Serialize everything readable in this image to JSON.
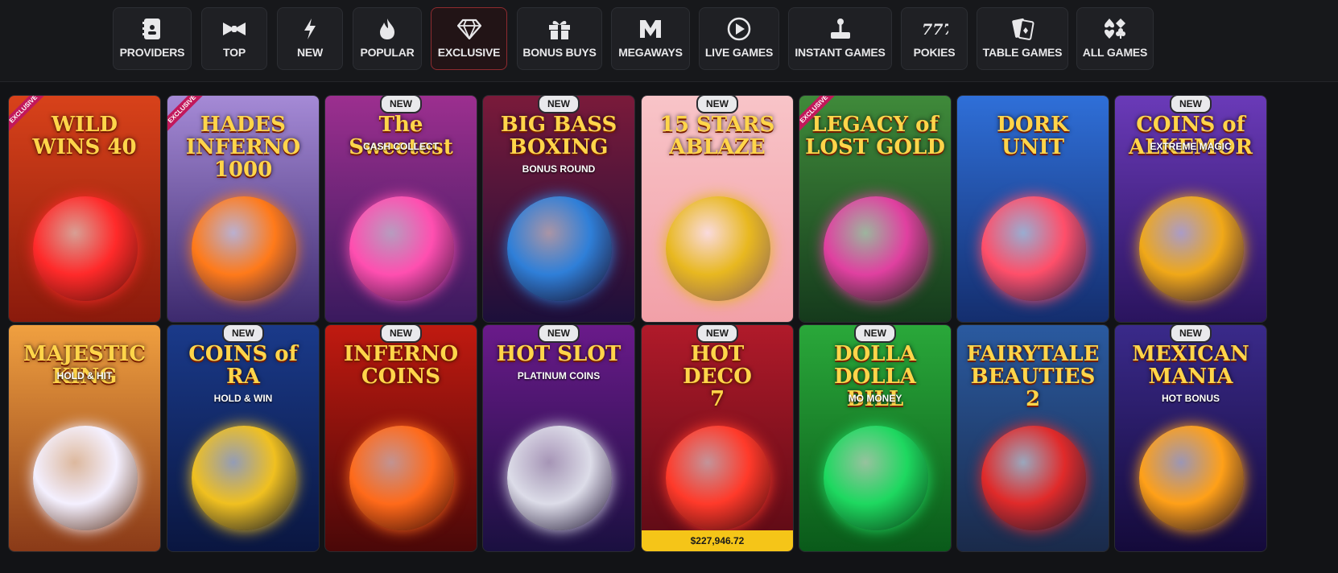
{
  "categories": [
    {
      "label": "PROVIDERS",
      "icon": "book-icon"
    },
    {
      "label": "TOP",
      "icon": "bowtie-icon"
    },
    {
      "label": "NEW",
      "icon": "lightning-icon"
    },
    {
      "label": "POPULAR",
      "icon": "flame-icon"
    },
    {
      "label": "EXCLUSIVE",
      "icon": "diamond-icon",
      "active": true
    },
    {
      "label": "BONUS BUYS",
      "icon": "gift-icon"
    },
    {
      "label": "MEGAWAYS",
      "icon": "megaways-m-icon"
    },
    {
      "label": "LIVE GAMES",
      "icon": "play-icon"
    },
    {
      "label": "INSTANT GAMES",
      "icon": "joystick-icon"
    },
    {
      "label": "POKIES",
      "icon": "777-icon"
    },
    {
      "label": "TABLE GAMES",
      "icon": "cards-icon"
    },
    {
      "label": "ALL GAMES",
      "icon": "card-suits-icon"
    }
  ],
  "badges": {
    "new": "NEW",
    "exclusive": "EXCLUSIVE"
  },
  "games": [
    {
      "title": "WILD\nWINS 40",
      "badge": "exclusive",
      "colors": [
        "#d8421a",
        "#8a1a0c"
      ],
      "accent": "#ff2a2a"
    },
    {
      "title": "HADES\nINFERNO\n1000",
      "badge": "exclusive",
      "colors": [
        "#a58ad6",
        "#3d2a6e"
      ],
      "accent": "#ff7a1a"
    },
    {
      "title": "The Sweetest",
      "subtitle": "CASH COLLECT",
      "badge": "new",
      "colors": [
        "#9c2f8f",
        "#3a1a5e"
      ],
      "accent": "#ff4fb0"
    },
    {
      "title": "BIG BASS\nBOXING",
      "subtitle": "BONUS ROUND",
      "badge": "new",
      "colors": [
        "#7a1a3a",
        "#1c0f3a"
      ],
      "accent": "#2f7fd8"
    },
    {
      "title": "15 STARS\nABLAZE",
      "badge": "new",
      "colors": [
        "#f8c4c8",
        "#f2a0a8"
      ],
      "accent": "#e8b820"
    },
    {
      "title": "LEGACY of\nLOST GOLD",
      "badge": "exclusive",
      "colors": [
        "#3f8a3a",
        "#153a1c"
      ],
      "accent": "#e040a0"
    },
    {
      "title": "DORK\nUNIT",
      "badge": "",
      "colors": [
        "#2f6fd8",
        "#142e6e"
      ],
      "accent": "#ff4f6a"
    },
    {
      "title": "COINS of ALKEMOR",
      "subtitle": "EXTREME MAGIC",
      "badge": "new",
      "colors": [
        "#6a3ab8",
        "#2a145e"
      ],
      "accent": "#f0a818"
    },
    {
      "title": "MAJESTIC KING",
      "subtitle": "HOLD & HIT",
      "badge": "",
      "colors": [
        "#f0a040",
        "#8a3a18"
      ],
      "accent": "#f4f0ff"
    },
    {
      "title": "COINS of\nRA",
      "subtitle": "HOLD & WIN",
      "badge": "new",
      "colors": [
        "#1a3a8a",
        "#0a1640"
      ],
      "accent": "#f0c020"
    },
    {
      "title": "INFERNO\nCOINS",
      "badge": "new",
      "colors": [
        "#c01a10",
        "#4a0808"
      ],
      "accent": "#ff6a1a"
    },
    {
      "title": "HOT SLOT",
      "subtitle": "PLATINUM COINS",
      "badge": "new",
      "colors": [
        "#6a1a8a",
        "#1a1040"
      ],
      "accent": "#dcdce8"
    },
    {
      "title": "HOT\nDECO\n7",
      "badge": "new",
      "colors": [
        "#b01a2a",
        "#5a0a14"
      ],
      "accent": "#ff3a2a",
      "jackpot": "$227,946.72"
    },
    {
      "title": "DOLLA DOLLA\nBILL",
      "subtitle": "MO MONEY",
      "badge": "new",
      "colors": [
        "#2aa83a",
        "#0a5a1a"
      ],
      "accent": "#1ed860"
    },
    {
      "title": "FAIRYTALE\nBEAUTIES 2",
      "badge": "",
      "colors": [
        "#2a5aa0",
        "#1a2a4a"
      ],
      "accent": "#e02a2a"
    },
    {
      "title": "MEXICAN\nMANIA",
      "subtitle": "HOT BONUS",
      "badge": "new",
      "colors": [
        "#3a2a8a",
        "#140a3a"
      ],
      "accent": "#ffa018"
    }
  ]
}
